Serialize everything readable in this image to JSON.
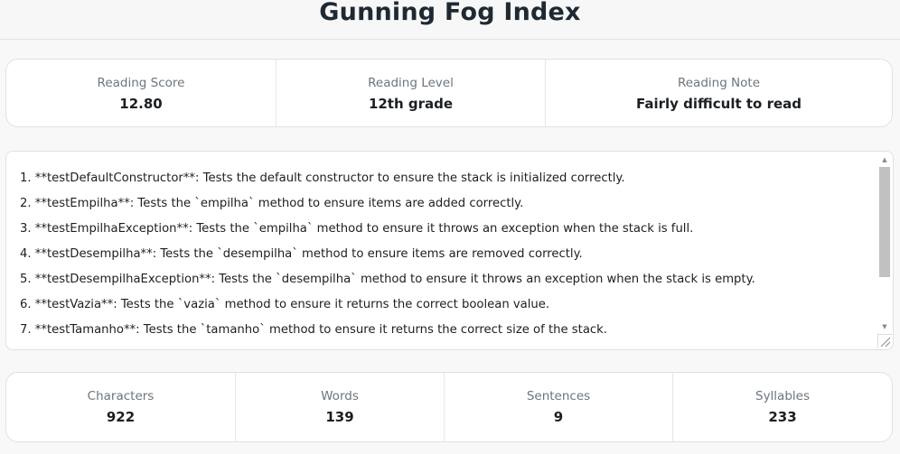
{
  "title": "Gunning Fog Index",
  "reading": {
    "score_label": "Reading Score",
    "score_value": "12.80",
    "level_label": "Reading Level",
    "level_value": "12th grade",
    "note_label": "Reading Note",
    "note_value": "Fairly difficult to read"
  },
  "text_lines": [
    "1. **testDefaultConstructor**: Tests the default constructor to ensure the stack is initialized correctly.",
    "2. **testEmpilha**: Tests the `empilha` method to ensure items are added correctly.",
    "3. **testEmpilhaException**: Tests the `empilha` method to ensure it throws an exception when the stack is full.",
    "4. **testDesempilha**: Tests the `desempilha` method to ensure items are removed correctly.",
    "5. **testDesempilhaException**: Tests the `desempilha` method to ensure it throws an exception when the stack is empty.",
    "6. **testVazia**: Tests the `vazia` method to ensure it returns the correct boolean value.",
    "7. **testTamanho**: Tests the `tamanho` method to ensure it returns the correct size of the stack."
  ],
  "stats": {
    "characters_label": "Characters",
    "characters_value": "922",
    "words_label": "Words",
    "words_value": "139",
    "sentences_label": "Sentences",
    "sentences_value": "9",
    "syllables_label": "Syllables",
    "syllables_value": "233"
  },
  "scrollbar": {
    "up_icon": "▲",
    "down_icon": "▼"
  }
}
